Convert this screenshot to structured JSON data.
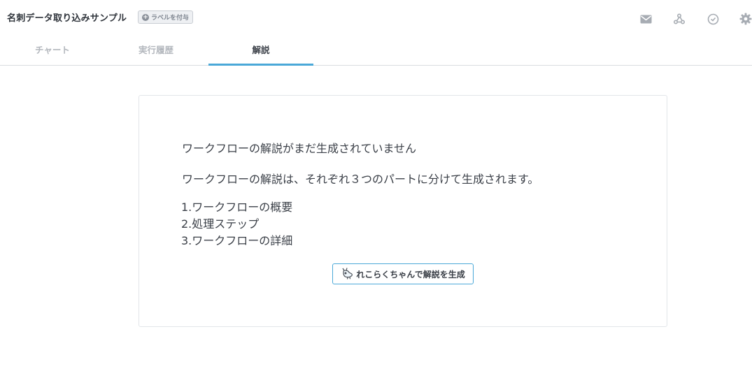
{
  "header": {
    "title": "名刺データ取り込みサンプル",
    "label_button": "ラベルを付与",
    "icons": [
      "mail-icon",
      "webhook-icon",
      "clock-icon",
      "gear-icon"
    ]
  },
  "tabs": [
    {
      "label": "チャート",
      "active": false
    },
    {
      "label": "実行履歴",
      "active": false
    },
    {
      "label": "解説",
      "active": true
    }
  ],
  "explanation": {
    "heading": "ワークフローの解説がまだ生成されていません",
    "description": "ワークフローの解説は、それぞれ３つのパートに分けて生成されます。",
    "steps": [
      "1.ワークフローの概要",
      "2.処理ステップ",
      "3.ワークフローの詳細"
    ],
    "generate_button": "れこらくちゃんで解説を生成"
  },
  "colors": {
    "accent": "#4aa8d8",
    "icon_gray": "#a7acb3",
    "text": "#3a3f47"
  }
}
